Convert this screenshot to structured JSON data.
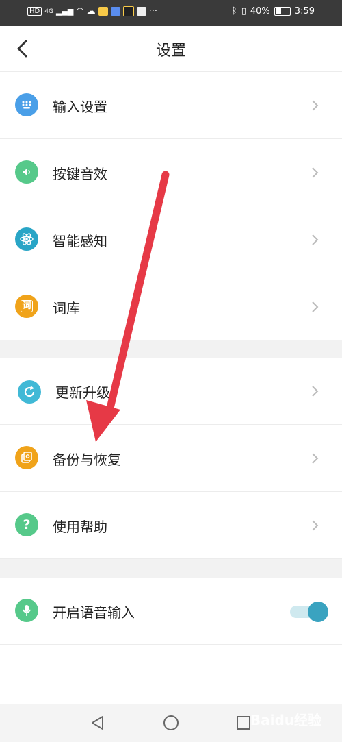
{
  "status_bar": {
    "hd_badge": "HD",
    "signal": "4G",
    "more": "···",
    "battery_percent": "40%",
    "time": "3:59"
  },
  "header": {
    "title": "设置",
    "back_icon": "chevron-left-icon"
  },
  "settings": {
    "group1": [
      {
        "label": "输入设置",
        "icon": "keyboard-icon",
        "color": "#4a9fe8"
      },
      {
        "label": "按键音效",
        "icon": "speaker-icon",
        "color": "#56c98a"
      },
      {
        "label": "智能感知",
        "icon": "atom-icon",
        "color": "#29a5c6"
      },
      {
        "label": "词库",
        "icon": "dictionary-icon",
        "icon_text": "词",
        "color": "#f0a31a"
      }
    ],
    "group2": [
      {
        "label": "更新升级",
        "icon": "refresh-icon",
        "color": "#41b9d6"
      },
      {
        "label": "备份与恢复",
        "icon": "backup-icon",
        "color": "#f0a31a"
      },
      {
        "label": "使用帮助",
        "icon": "help-icon",
        "icon_text": "?",
        "color": "#56c98a"
      }
    ],
    "group3": [
      {
        "label": "开启语音输入",
        "icon": "microphone-icon",
        "color": "#56c98a",
        "toggle_on": true
      }
    ]
  },
  "nav_bar": {
    "back": "triangle-back-icon",
    "home": "circle-home-icon",
    "recents": "square-recents-icon"
  },
  "annotation": {
    "arrow_color": "#e63946"
  },
  "watermark": "Baidu经验"
}
